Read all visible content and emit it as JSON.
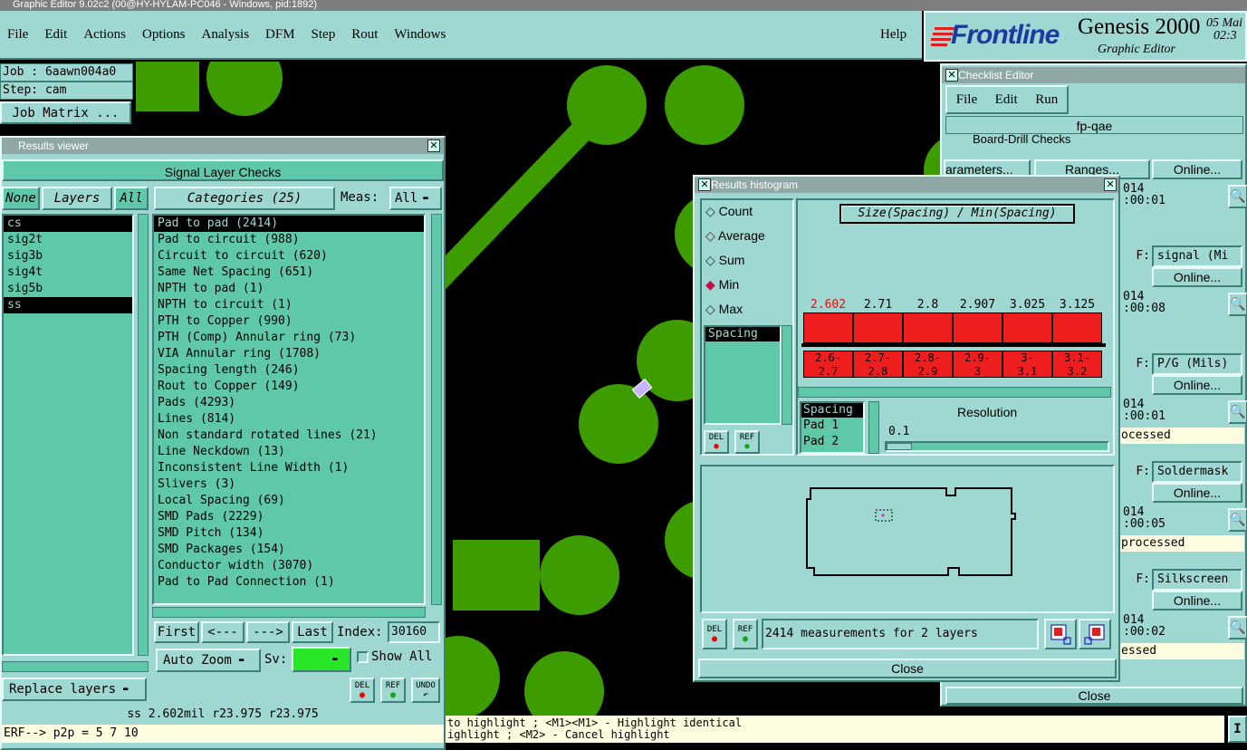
{
  "window_title": "Graphic Editor 9.02c2 (00@HY-HYLAM-PC046 - Windows, pid:1892)",
  "menu": [
    "File",
    "Edit",
    "Actions",
    "Options",
    "Analysis",
    "DFM",
    "Step",
    "Rout",
    "Windows"
  ],
  "help": "Help",
  "brand": {
    "logo": "Frontline",
    "product": "Genesis 2000",
    "subtitle": "Graphic Editor",
    "date": "05 Mai",
    "time": "02:3"
  },
  "job": {
    "job_label": "Job : 6aawn004a0",
    "step_label": "Step: cam",
    "matrix_button": "Job Matrix ..."
  },
  "results_viewer": {
    "title": "Results viewer",
    "header": "Signal Layer Checks",
    "none_btn": "None",
    "layers_btn": "Layers",
    "all_btn": "All",
    "categories_btn": "Categories (25)",
    "meas_label": "Meas:",
    "meas_value": "All",
    "layers": [
      "cs",
      "sig2t",
      "sig3b",
      "sig4t",
      "sig5b",
      "ss"
    ],
    "selected_layers": [
      0,
      5
    ],
    "categories": [
      "Pad to pad (2414)",
      "Pad to circuit (988)",
      "Circuit to circuit (620)",
      "Same Net Spacing (651)",
      "NPTH to pad (1)",
      "NPTH to circuit (1)",
      "PTH to Copper (990)",
      "PTH (Comp) Annular ring (73)",
      "VIA Annular ring (1708)",
      "Spacing length (246)",
      "Rout to Copper (149)",
      "Pads (4293)",
      "Lines (814)",
      "Non standard rotated lines (21)",
      "Line Neckdown (13)",
      "Inconsistent Line Width (1)",
      "Slivers (3)",
      "Local Spacing (69)",
      "SMD Pads (2229)",
      "SMD Pitch (134)",
      "SMD Packages (154)",
      "Conductor width (3070)",
      "Pad to Pad Connection (1)"
    ],
    "nav": {
      "first": "First",
      "prev": "<---",
      "next": "--->",
      "last": "Last",
      "index_label": "Index:",
      "index_value": "30160"
    },
    "auto_zoom": "Auto Zoom",
    "sv_label": "Sv:",
    "show_all": "Show All",
    "replace_layers": "Replace layers",
    "del": "DEL",
    "ref": "REF",
    "undo": "UNDO",
    "status": "ss 2.602mil  r23.975  r23.975",
    "command": "ERF--> p2p = 5 7 10"
  },
  "histogram": {
    "title": "Results histogram",
    "modes": [
      "Count",
      "Average",
      "Sum",
      "Min",
      "Max"
    ],
    "selected_mode": "Min",
    "graph_title": "Size(Spacing) / Min(Spacing)",
    "list_item": "Spacing",
    "bar_values": [
      "2.602",
      "2.71",
      "2.8",
      "2.907",
      "3.025",
      "3.125"
    ],
    "bin_labels": [
      [
        "2.6-",
        "2.7"
      ],
      [
        "2.7-",
        "2.8"
      ],
      [
        "2.8-",
        "2.9"
      ],
      [
        "2.9-",
        "3"
      ],
      [
        "3-",
        "3.1"
      ],
      [
        "3.1-",
        "3.2"
      ]
    ],
    "sub_list": [
      "Spacing",
      "Pad 1",
      "Pad 2"
    ],
    "resolution_label": "Resolution",
    "resolution_value": "0.1",
    "measurements": "2414 measurements for 2 layers",
    "close": "Close",
    "del": "DEL",
    "ref": "REF"
  },
  "checklist": {
    "title": "Checklist Editor",
    "menu": [
      "File",
      "Edit",
      "Run"
    ],
    "name": "fp-qae",
    "first_row": "Board-Drill Checks",
    "erf": "ERF:",
    "rows": [
      {
        "param": "arameters...",
        "ranges": "Ranges...",
        "online": "Online...",
        "date": "014",
        "time": ":00:01"
      },
      {
        "erf_value": "signal (Mi",
        "online": "Online...",
        "date": "014",
        "time": ":00:08"
      },
      {
        "erf_value": "P/G (Mils)",
        "online": "Online...",
        "date": "014",
        "time": ":00:01",
        "status": "ocessed"
      },
      {
        "erf_value": "Soldermask",
        "online": "Online...",
        "date": "014",
        "time": ":00:05",
        "status": "processed"
      },
      {
        "erf_value": "Silkscreen",
        "online": "Online...",
        "date": "014",
        "time": ":00:02",
        "status": "essed"
      }
    ],
    "close": "Close"
  },
  "messages": {
    "line1": " to highlight ; <M1><M1> - Highlight identical",
    "line2": "ighlight ; <M2> - Cancel highlight"
  },
  "colors": {
    "panel": "#9fd7d2",
    "list_bg": "#5ec8a8",
    "copper": "#3c9c00",
    "bar": "#ef1e1e"
  }
}
